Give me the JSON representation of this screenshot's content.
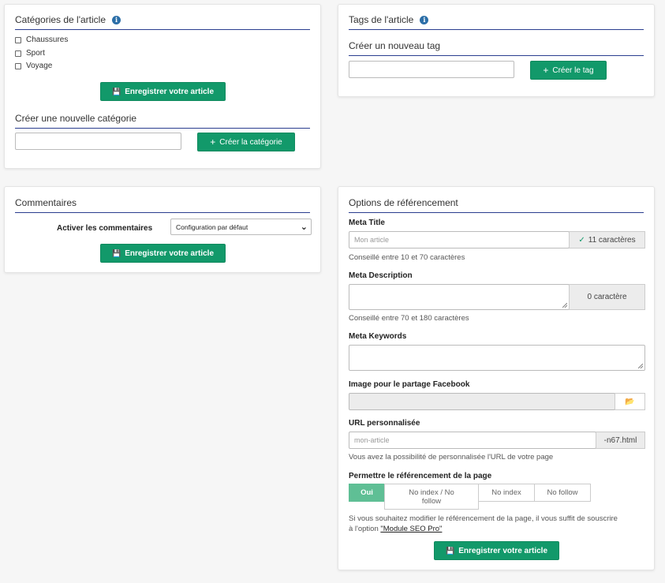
{
  "categories": {
    "title": "Catégories de l'article",
    "info_glyph": "i",
    "items": [
      "Chaussures",
      "Sport",
      "Voyage"
    ],
    "save_label": "Enregistrer votre article",
    "new_title": "Créer une nouvelle catégorie",
    "create_label": "Créer la catégorie"
  },
  "tags": {
    "title": "Tags de l'article",
    "info_glyph": "i",
    "new_title": "Créer un nouveau tag",
    "create_label": "Créer le tag"
  },
  "comments": {
    "title": "Commentaires",
    "enable_label": "Activer les commentaires",
    "select_value": "Configuration par défaut",
    "save_label": "Enregistrer votre article"
  },
  "seo": {
    "title": "Options de référencement",
    "meta_title_label": "Meta Title",
    "meta_title_placeholder": "Mon article",
    "meta_title_count": "11 caractères",
    "meta_title_help": "Conseillé entre 10 et 70 caractères",
    "meta_desc_label": "Meta Description",
    "meta_desc_count": "0 caractère",
    "meta_desc_help": "Conseillé entre 70 et 180 caractères",
    "meta_keywords_label": "Meta Keywords",
    "fb_image_label": "Image pour le partage Facebook",
    "url_label": "URL personnalisée",
    "url_placeholder": "mon-article",
    "url_suffix": "-n67.html",
    "url_help": "Vous avez la possibilité de personnalisée l'URL de votre page",
    "indexing_label": "Permettre le référencement de la page",
    "options": [
      "Oui",
      "No index / No follow",
      "No index",
      "No follow"
    ],
    "notice_line1": "Si vous souhaitez modifier le référencement de la page, il vous suffit de souscrire",
    "notice_prefix": "à l'option ",
    "notice_link": "\"Module SEO Pro\"",
    "save_label": "Enregistrer votre article"
  },
  "colors": {
    "accent_green": "#12996a",
    "active_segment": "#5fbf95",
    "title_rule": "#2a3d8f"
  }
}
